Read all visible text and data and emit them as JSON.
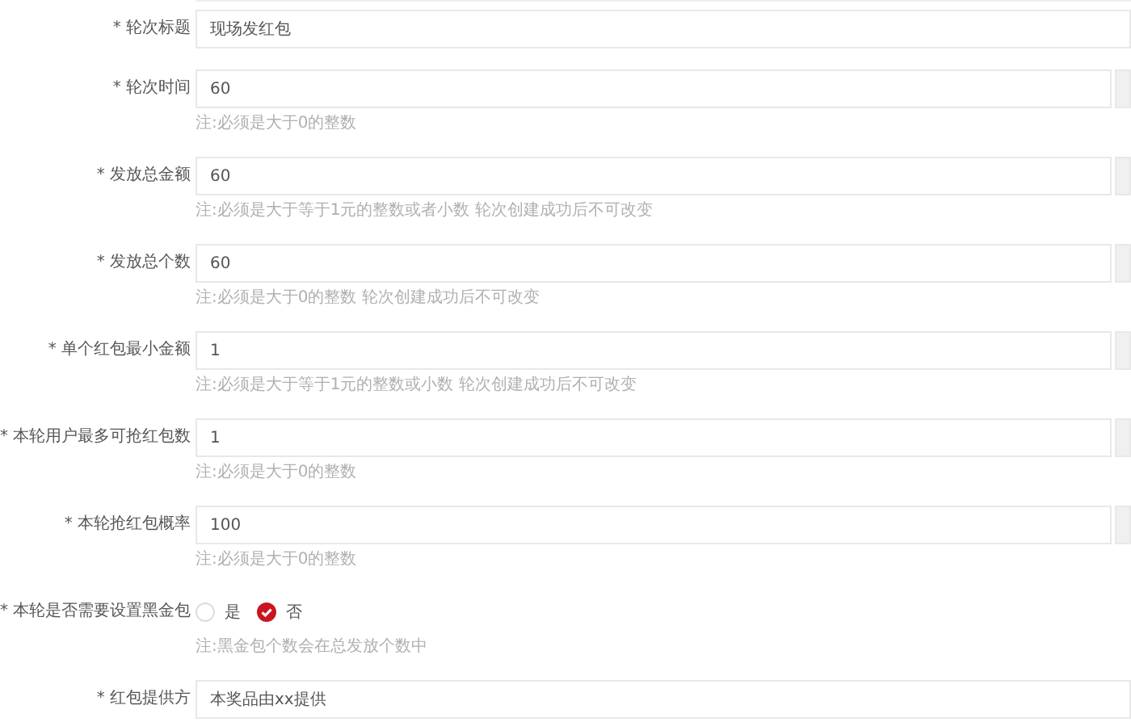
{
  "fields": [
    {
      "kind": "input",
      "label": "* 轮次标题",
      "value": "现场发红包",
      "addon": false
    },
    {
      "kind": "input",
      "label": "* 轮次时间",
      "value": "60",
      "addon": true,
      "hint": "注:必须是大于0的整数"
    },
    {
      "kind": "input",
      "label": "* 发放总金额",
      "value": "60",
      "addon": true,
      "hint": "注:必须是大于等于1元的整数或者小数 轮次创建成功后不可改变"
    },
    {
      "kind": "input",
      "label": "* 发放总个数",
      "value": "60",
      "addon": true,
      "hint": "注:必须是大于0的整数 轮次创建成功后不可改变"
    },
    {
      "kind": "input",
      "label": "* 单个红包最小金额",
      "value": "1",
      "addon": true,
      "hint": "注:必须是大于等于1元的整数或小数 轮次创建成功后不可改变"
    },
    {
      "kind": "input",
      "label": "* 本轮用户最多可抢红包数",
      "value": "1",
      "addon": true,
      "hint": "注:必须是大于0的整数"
    },
    {
      "kind": "input",
      "label": "* 本轮抢红包概率",
      "value": "100",
      "addon": true,
      "hint": "注:必须是大于0的整数"
    },
    {
      "kind": "radio",
      "label": "* 本轮是否需要设置黑金包",
      "options": [
        {
          "label": "是",
          "selected": false
        },
        {
          "label": "否",
          "selected": true
        }
      ],
      "hint": "注:黑金包个数会在总发放个数中"
    },
    {
      "kind": "input",
      "label": "* 红包提供方",
      "value": "本奖品由xx提供",
      "addon": false
    }
  ]
}
